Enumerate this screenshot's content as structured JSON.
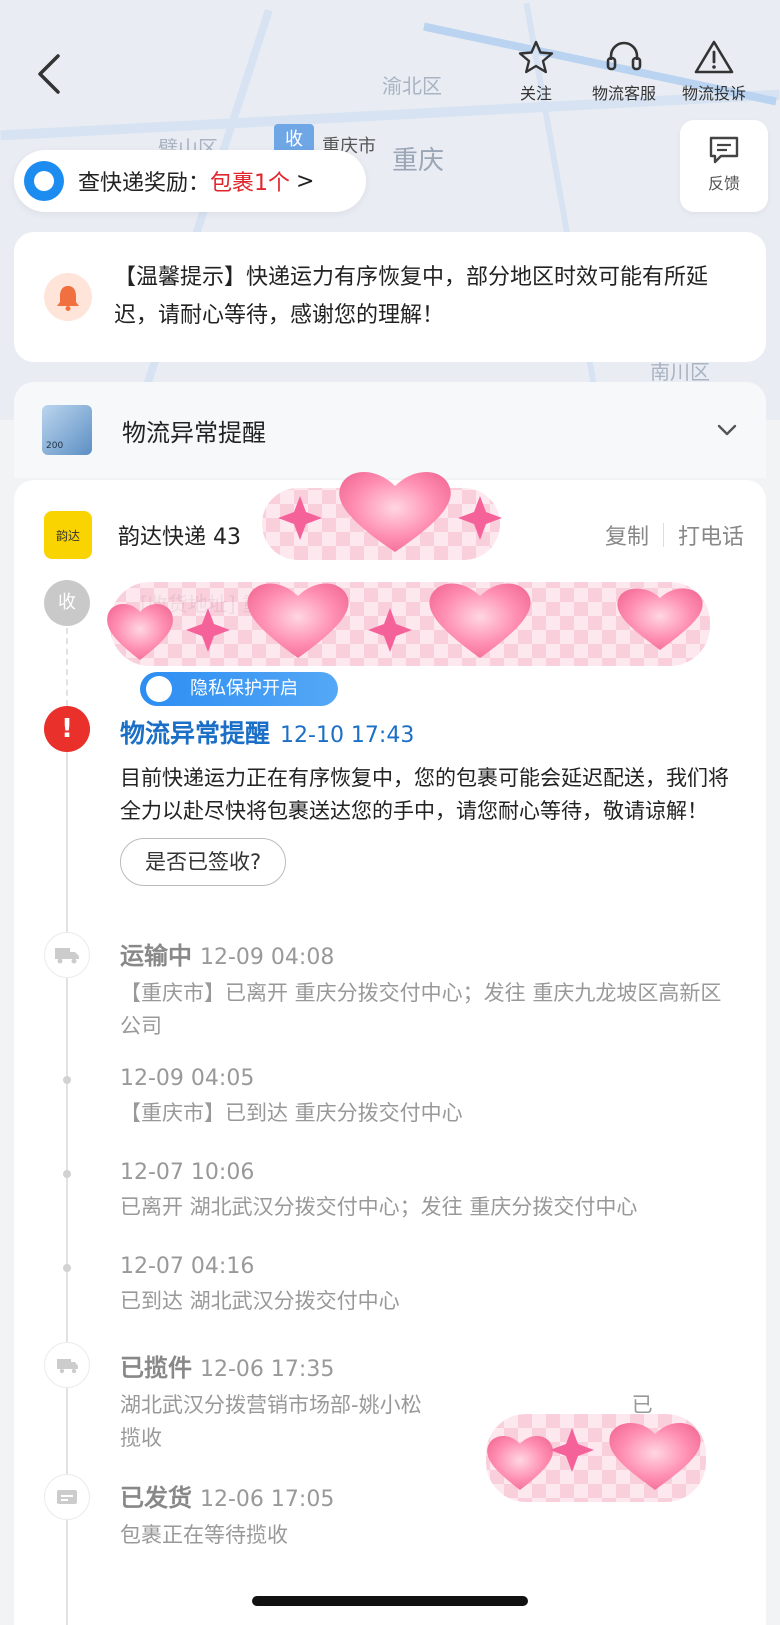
{
  "map": {
    "labels": [
      "渝北区",
      "璧山区",
      "重庆市",
      "重庆",
      "南川区"
    ],
    "pin_label": "收"
  },
  "topbar": {
    "follow_label": "关注",
    "service_label": "物流客服",
    "complaint_label": "物流投诉"
  },
  "feedback": {
    "label": "反馈"
  },
  "reward": {
    "prefix": "查快递奖励：",
    "highlight": "包裹1个",
    "suffix": ">"
  },
  "tip": {
    "text": "【温馨提示】快递运力有序恢复中，部分地区时效可能有所延迟，请耐心等待，感谢您的理解！"
  },
  "alert_section": {
    "title": "物流异常提醒",
    "thumb_caption": "200"
  },
  "courier": {
    "logo_text": "韵达",
    "name": "韵达快递 43",
    "copy_label": "复制",
    "call_label": "打电话"
  },
  "receiver": {
    "badge": "收",
    "address_prefix": "[收货地址] 重",
    "privacy_label": "隐私保护开启"
  },
  "events": {
    "alert": {
      "status": "物流异常提醒",
      "time": "12-10 17:43",
      "body": "目前快递运力正在有序恢复中，您的包裹可能会延迟配送，我们将全力以赴尽快将包裹送达您的手中，请您耐心等待，敬请谅解！",
      "sign_button": "是否已签收?"
    },
    "transit": {
      "status": "运输中",
      "time": "12-09 04:08",
      "body": "【重庆市】已离开 重庆分拨交付中心；发往 重庆九龙坡区高新区公司"
    },
    "e2": {
      "time": "12-09 04:05",
      "body": "【重庆市】已到达 重庆分拨交付中心"
    },
    "e3": {
      "time": "12-07 10:06",
      "body": "已离开 湖北武汉分拨交付中心；发往 重庆分拨交付中心"
    },
    "e4": {
      "time": "12-07 04:16",
      "body": "已到达 湖北武汉分拨交付中心"
    },
    "picked": {
      "status": "已揽件",
      "time": "12-06 17:35",
      "body_line1_prefix": "湖北武汉分拨营销市场部-姚小松",
      "body_line1_suffix": "已",
      "body_line2": "揽收"
    },
    "shipped": {
      "status": "已发货",
      "time": "12-06 17:05",
      "body": "包裹正在等待揽收"
    }
  },
  "colors": {
    "accent_blue": "#1b6fc6",
    "alert_red": "#e9302b",
    "reward_red": "#e0262d",
    "yunda_yellow": "#fad400"
  }
}
